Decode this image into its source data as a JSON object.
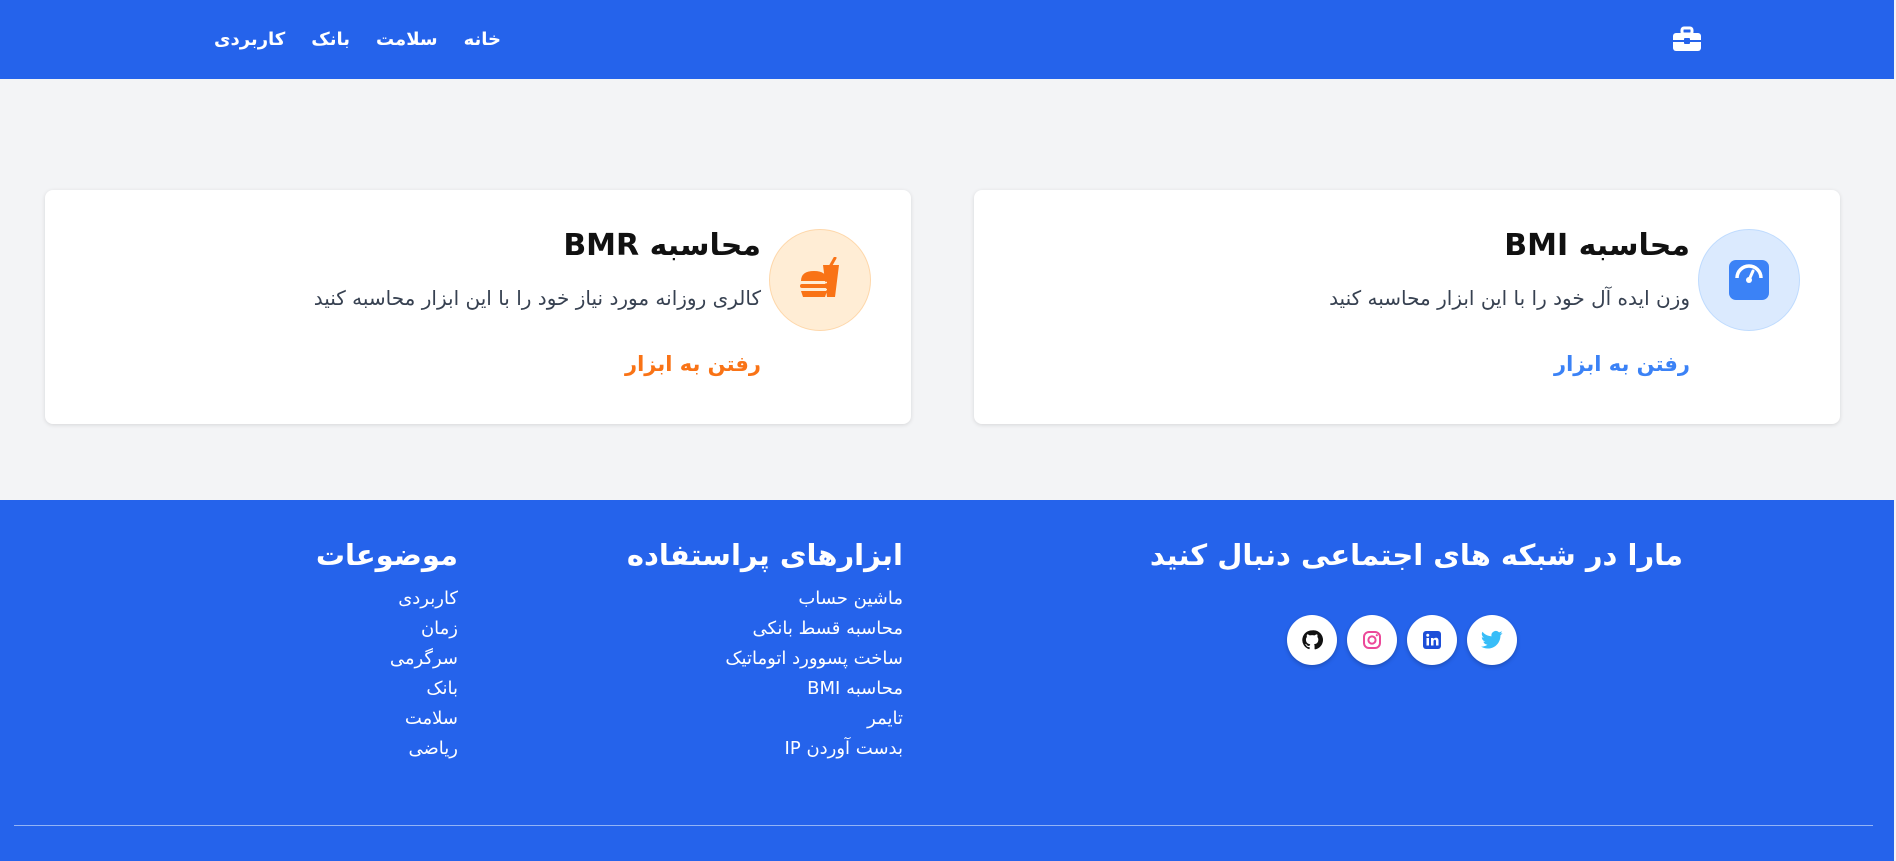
{
  "nav": {
    "items": [
      {
        "label": "خانه"
      },
      {
        "label": "سلامت"
      },
      {
        "label": "بانک"
      },
      {
        "label": "کاربردی"
      }
    ],
    "logo_icon": "toolbox-icon"
  },
  "cards": {
    "bmi": {
      "title": "محاسبه BMI",
      "description": "وزن ایده آل خود را با این ابزار محاسبه کنید",
      "link": "رفتن به ابزار",
      "icon": "scale-gauge-icon",
      "accent": "#3b82f6"
    },
    "bmr": {
      "title": "محاسبه BMR",
      "description": "کالری روزانه مورد نیاز خود را با این ابزار محاسبه کنید",
      "link": "رفتن به ابزار",
      "icon": "burger-soda-icon",
      "accent": "#f97316"
    }
  },
  "footer": {
    "social": {
      "heading": "مارا در شبکه های اجتماعی دنبال کنید",
      "icons": [
        "twitter-icon",
        "linkedin-icon",
        "instagram-icon",
        "github-icon"
      ]
    },
    "tools": {
      "heading": "ابزارهای پراستفاده",
      "items": [
        "ماشین حساب",
        "محاسبه قسط بانکی",
        "ساخت پسوورد اتوماتیک",
        "محاسبه BMI",
        "تایمر",
        "بدست آوردن IP"
      ]
    },
    "topics": {
      "heading": "موضوعات",
      "items": [
        "کاربردی",
        "زمان",
        "سرگرمی",
        "بانک",
        "سلامت",
        "ریاضی"
      ]
    }
  },
  "colors": {
    "primary": "#2563eb",
    "background": "#f3f4f6"
  }
}
